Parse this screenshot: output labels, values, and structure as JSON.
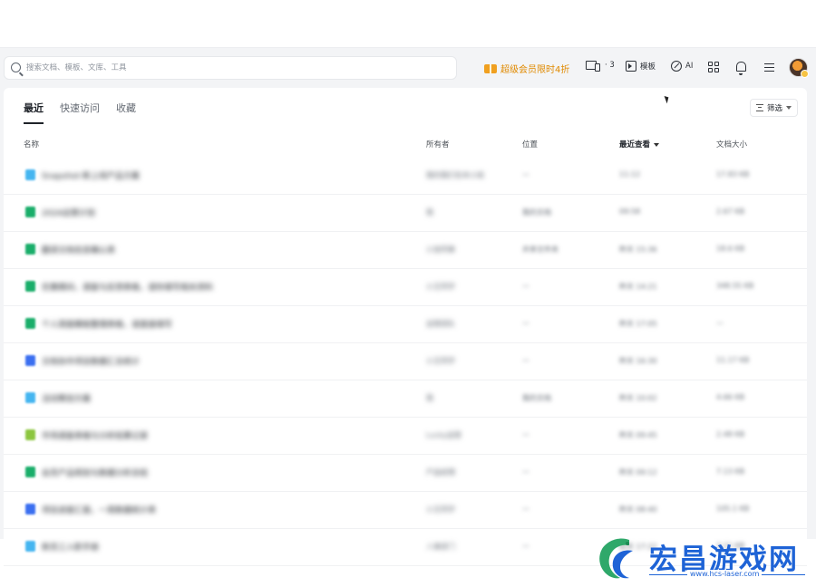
{
  "search": {
    "placeholder": "搜索文档、模板、文库、工具"
  },
  "toolbar": {
    "promo_label": "超级会员限时4折",
    "devices_count": "· 3",
    "template_label": "模板",
    "ai_label": "AI",
    "icons": [
      "search-icon",
      "gift-icon",
      "devices-icon",
      "template-icon",
      "ai-icon",
      "apps-grid-icon",
      "bell-icon",
      "menu-icon"
    ]
  },
  "tabs": [
    {
      "label": "最近",
      "active": true
    },
    {
      "label": "快速访问",
      "active": false
    },
    {
      "label": "收藏",
      "active": false
    }
  ],
  "filter": {
    "label": "筛选"
  },
  "table": {
    "columns": {
      "name": "名称",
      "owner": "所有者",
      "location": "位置",
      "last_viewed": "最近查看",
      "size": "文档大小"
    },
    "rows": [
      {
        "name": "Snapshot·新上线产品方案",
        "owner": "我的我们在本小组",
        "location": "—",
        "viewed": "11:12",
        "size": "17.83 KB",
        "icon_color": "#45b5f0"
      },
      {
        "name": "2024运营计划",
        "owner": "我",
        "location": "我的文档",
        "viewed": "09:58",
        "size": "2.67 KB",
        "icon_color": "#1aae6a"
      },
      {
        "name": "翻译文档信息确认表",
        "owner": "小张同事",
        "location": "共享文件夹",
        "viewed": "昨天 15:36",
        "size": "18.6 KB",
        "icon_color": "#1aae6a"
      },
      {
        "name": "优惠期间，调查与反馈表格，请你填写相关资料",
        "owner": "小王同学",
        "location": "—",
        "viewed": "昨天 14:21",
        "size": "348.55 KB",
        "icon_color": "#1aae6a"
      },
      {
        "name": "个人周报模板整理表格，请直接填写",
        "owner": "运营团队",
        "location": "—",
        "viewed": "昨天 17:05",
        "size": "—",
        "icon_color": "#1aae6a"
      },
      {
        "name": "文档协作项目数据汇总统计",
        "owner": "小王同学",
        "location": "—",
        "viewed": "昨天 16:30",
        "size": "11.17 KB",
        "icon_color": "#3b6ff0"
      },
      {
        "name": "活动策划方案",
        "owner": "我",
        "location": "我的文档",
        "viewed": "昨天 10:02",
        "size": "4.66 KB",
        "icon_color": "#45b5f0"
      },
      {
        "name": "市场调查表格与分析结果记录",
        "owner": "Lucky运营",
        "location": "—",
        "viewed": "昨天 09:45",
        "size": "2.48 KB",
        "icon_color": "#8cc63f"
      },
      {
        "name": "会员产品规划与数据分析总结",
        "owner": "产品经理",
        "location": "—",
        "viewed": "昨天 09:12",
        "size": "7.13 KB",
        "icon_color": "#1aae6a"
      },
      {
        "name": "项目进度汇报，一周数据统计表",
        "owner": "小王同学",
        "location": "—",
        "viewed": "昨天 08:40",
        "size": "105.1 KB",
        "icon_color": "#3b6ff0"
      },
      {
        "name": "新员工入职手册",
        "owner": "人事部门",
        "location": "—",
        "viewed": "前天 17:22",
        "size": "3.21 KB",
        "icon_color": "#45b5f0"
      }
    ]
  },
  "watermark": {
    "title": "宏昌游戏网",
    "url": "www.hcs-laser.com",
    "color": "#1e63d6"
  }
}
